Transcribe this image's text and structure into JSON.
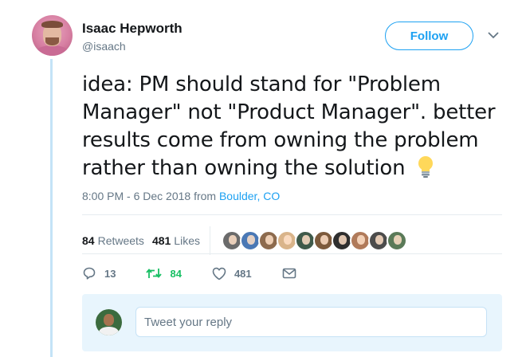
{
  "author": {
    "display_name": "Isaac Hepworth",
    "handle": "@isaach"
  },
  "follow_button": {
    "label": "Follow"
  },
  "tweet": {
    "lines": [
      "idea: PM should stand for \"Problem",
      "Manager\" not \"Product Manager\". better",
      "results come from owning the problem",
      "rather than owning the solution"
    ],
    "emoji": "lightbulb-icon",
    "time": "8:00 PM - 6 Dec 2018",
    "from_label": "from",
    "location": "Boulder, CO"
  },
  "stats": {
    "retweets_count": "84",
    "retweets_label": "Retweets",
    "likes_count": "481",
    "likes_label": "Likes",
    "likers": [
      "#6b6b6b",
      "#4a78b5",
      "#8d6b4e",
      "#d9b48a",
      "#3f5a4a",
      "#7d5a3c",
      "#2f2f2f",
      "#b07a5a",
      "#4c4c4c",
      "#5a7a58"
    ]
  },
  "actions": {
    "reply_count": "13",
    "retweet_count": "84",
    "like_count": "481"
  },
  "reply": {
    "placeholder": "Tweet your reply"
  },
  "colors": {
    "accent": "#1da1f2",
    "retweet_green": "#17bf63",
    "muted": "#657786"
  }
}
